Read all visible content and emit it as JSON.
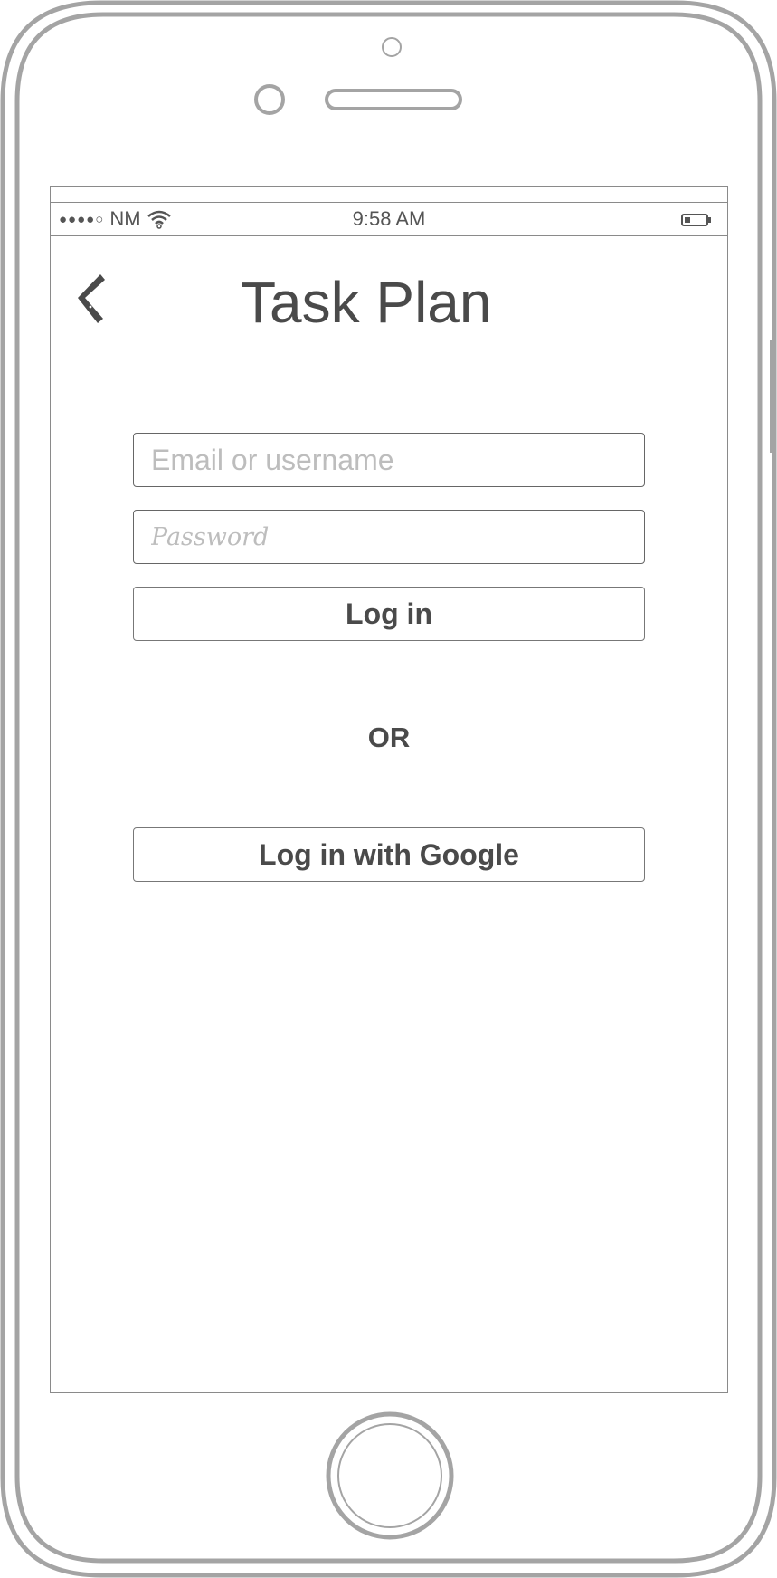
{
  "status_bar": {
    "carrier": "NM",
    "time": "9:58 AM",
    "signal_icon": "signal-dots-icon",
    "wifi_icon": "wifi-icon",
    "battery_icon": "battery-icon"
  },
  "header": {
    "back_icon": "chevron-left-icon",
    "title": "Task Plan"
  },
  "login_form": {
    "email_placeholder": "Email or username",
    "email_value": "",
    "password_placeholder": "Password",
    "password_value": "",
    "login_label": "Log in",
    "divider_label": "OR",
    "google_label": "Log in with Google"
  },
  "colors": {
    "outline": "#8a8a8a",
    "text": "#4a4a4a",
    "placeholder": "#bdbdbd"
  }
}
